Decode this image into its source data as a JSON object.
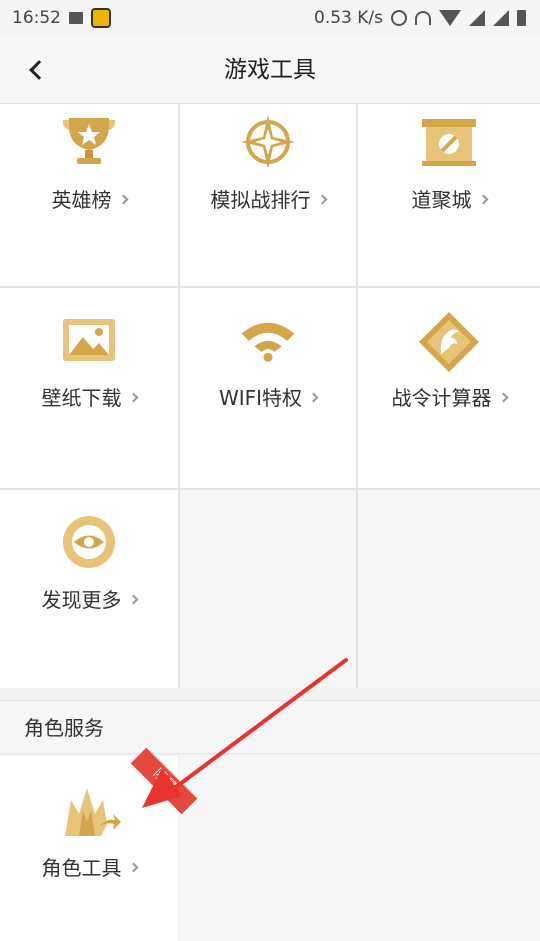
{
  "status_bar": {
    "time": "16:52",
    "speed": "0.53 K/s",
    "icons": [
      "image-icon",
      "app-icon",
      "alarm-icon",
      "headset-icon",
      "wifi-icon",
      "signal-icon",
      "signal-icon",
      "battery-icon"
    ]
  },
  "header": {
    "title": "游戏工具",
    "back_icon": "chevron-left-icon"
  },
  "tools": [
    {
      "label": "英雄榜",
      "icon": "trophy-icon"
    },
    {
      "label": "模拟战排行",
      "icon": "compass-star-icon"
    },
    {
      "label": "道聚城",
      "icon": "banner-icon"
    },
    {
      "label": "壁纸下载",
      "icon": "picture-icon"
    },
    {
      "label": "WIFI特权",
      "icon": "wifi-icon"
    },
    {
      "label": "战令计算器",
      "icon": "dragon-diamond-icon"
    },
    {
      "label": "发现更多",
      "icon": "eye-icon"
    }
  ],
  "section": {
    "title": "角色服务"
  },
  "role_tool": {
    "label": "角色工具",
    "badge": "限量",
    "icon": "crown-arrow-icon"
  },
  "colors": {
    "gold": "#d4a64a",
    "ribbon": "#e5483e",
    "annotation_arrow": "#e8332f"
  }
}
